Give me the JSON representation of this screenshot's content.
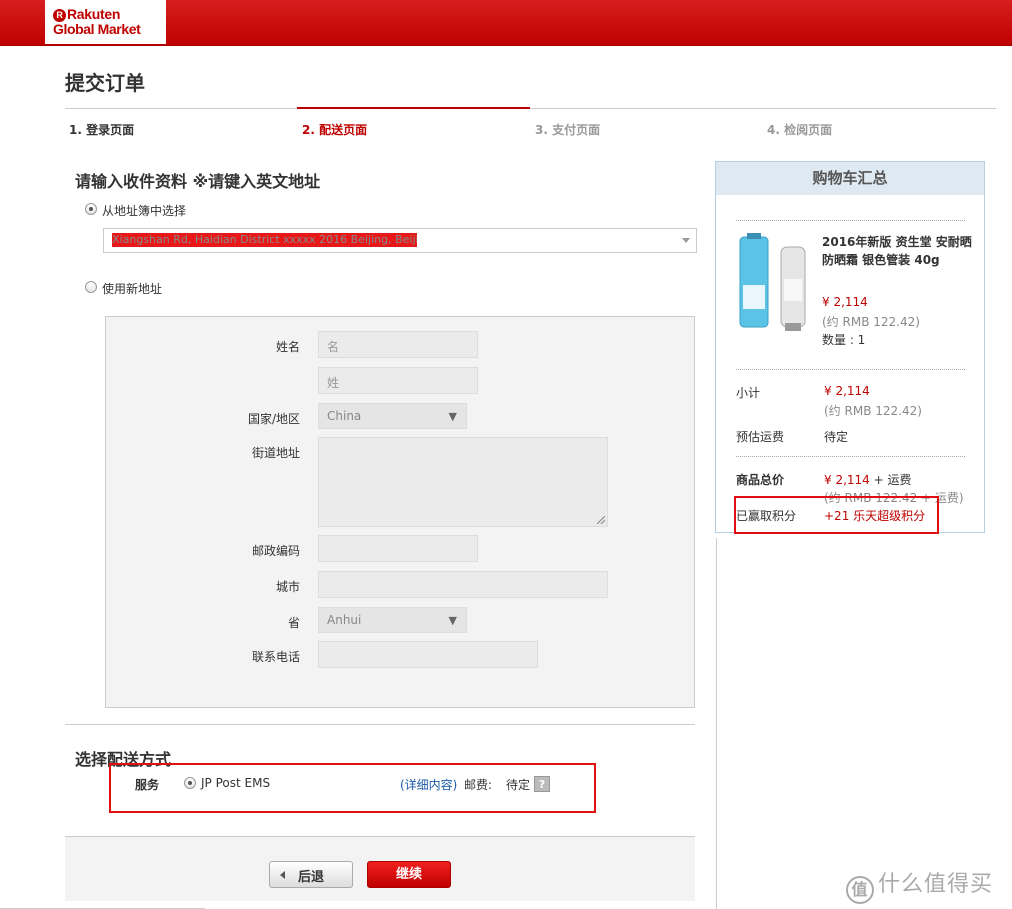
{
  "header": {
    "logo_line1": "Rakuten",
    "logo_line2": "Global Market",
    "logo_r": "R"
  },
  "page_title": "提交订单",
  "steps": [
    "1. 登录页面",
    "2. 配送页面",
    "3. 支付页面",
    "4. 检阅页面"
  ],
  "address": {
    "title": "请输入收件资料 ※请键入英文地址",
    "option_book": "从地址簿中选择",
    "option_new": "使用新地址",
    "selected_address": "Xiangshan Rd, Haidian District xxxxx 2016 Beijing, Beijing"
  },
  "form": {
    "name_label": "姓名",
    "first_placeholder": "名",
    "last_placeholder": "姓",
    "country_label": "国家/地区",
    "country_value": "China",
    "street_label": "街道地址",
    "zip_label": "邮政编码",
    "city_label": "城市",
    "province_label": "省",
    "province_value": "Anhui",
    "phone_label": "联系电话"
  },
  "shipping": {
    "title": "选择配送方式",
    "service_label": "服务",
    "method": "JP Post EMS",
    "details_link": "(详细内容)",
    "fee_label": "邮费:",
    "fee_value": "待定",
    "help": "?"
  },
  "buttons": {
    "back": "后退",
    "next": "继续"
  },
  "cart": {
    "title": "购物车汇总",
    "product_name": "2016年新版 资生堂 安耐晒 防晒霜 银色管装 40g",
    "price": "¥ 2,114",
    "price_rmb": "(约 RMB 122.42)",
    "qty": "数量 : 1",
    "subtotal_label": "小计",
    "subtotal": "¥ 2,114",
    "subtotal_rmb": "(约 RMB 122.42)",
    "shipping_label": "预估运费",
    "shipping_value": "待定",
    "total_label": "商品总价",
    "total": "¥ 2,114",
    "total_suffix": " + 运费",
    "total_rmb": "(约 RMB 122.42 + 运费)",
    "points_label": "已赢取积分",
    "points_value": "+21 乐天超级积分"
  },
  "watermark": {
    "icon": "值",
    "text": "什么值得买"
  },
  "colors": {
    "brand_red": "#bf0000",
    "link_blue": "#1a5aa8",
    "cart_header": "#dfe9f1"
  }
}
